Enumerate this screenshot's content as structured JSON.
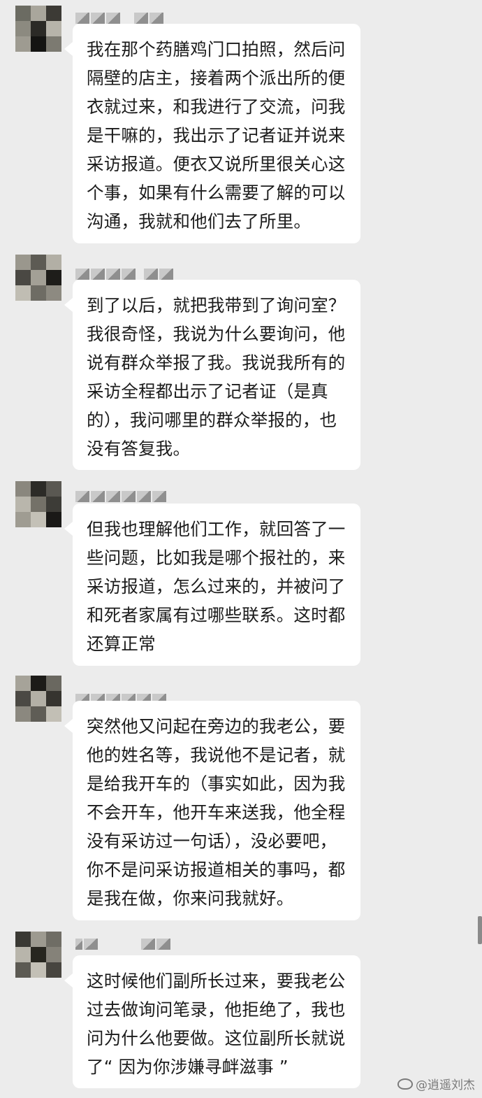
{
  "messages": [
    {
      "text": "我在那个药膳鸡门口拍照，然后问隔壁的店主，接着两个派出所的便衣就过来，和我进行了交流，问我是干嘛的，我出示了记者证并说来采访报道。便衣又说所里很关心这个事，如果有什么需要了解的可以沟通，我就和他们去了所里。"
    },
    {
      "text": "到了以后，就把我带到了询问室？我很奇怪，我说为什么要询问，他说有群众举报了我。我说我所有的采访全程都出示了记者证（是真的），我问哪里的群众举报的，也没有答复我。"
    },
    {
      "text": "但我也理解他们工作，就回答了一些问题，比如我是哪个报社的，来采访报道，怎么过来的，并被问了和死者家属有过哪些联系。这时都还算正常"
    },
    {
      "text": "突然他又问起在旁边的我老公，要他的姓名等，我说他不是记者，就是给我开车的（事实如此，因为我不会开车，他开车来送我，他全程没有采访过一句话），没必要吧，你不是问采访报道相关的事吗，都是我在做，你来问我就好。"
    },
    {
      "text": "这时候他们副所长过来，要我老公过去做询问笔录，他拒绝了，我也问为什么他要做。这位副所长就说了“ 因为你涉嫌寻衅滋事 ”"
    }
  ],
  "watermark": {
    "text": "@逍遥刘杰",
    "icon": "weibo-icon"
  },
  "colors": {
    "background": "#ececec",
    "bubble": "#ffffff",
    "text": "#1b1b1b"
  }
}
